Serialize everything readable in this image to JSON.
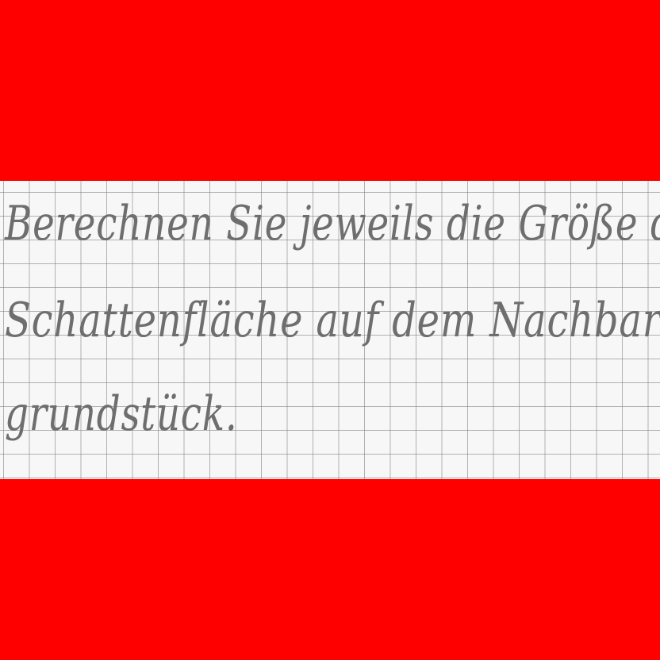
{
  "colors": {
    "border": "#ff0000",
    "paper": "#f7f7f7",
    "grid": "#8a8a8a",
    "ink": "#6e6e6e"
  },
  "handwriting": {
    "lines": [
      "Berechnen Sie jeweils die Größe der",
      "Schattenfläche auf dem Nachbar-",
      "grundstück."
    ]
  }
}
